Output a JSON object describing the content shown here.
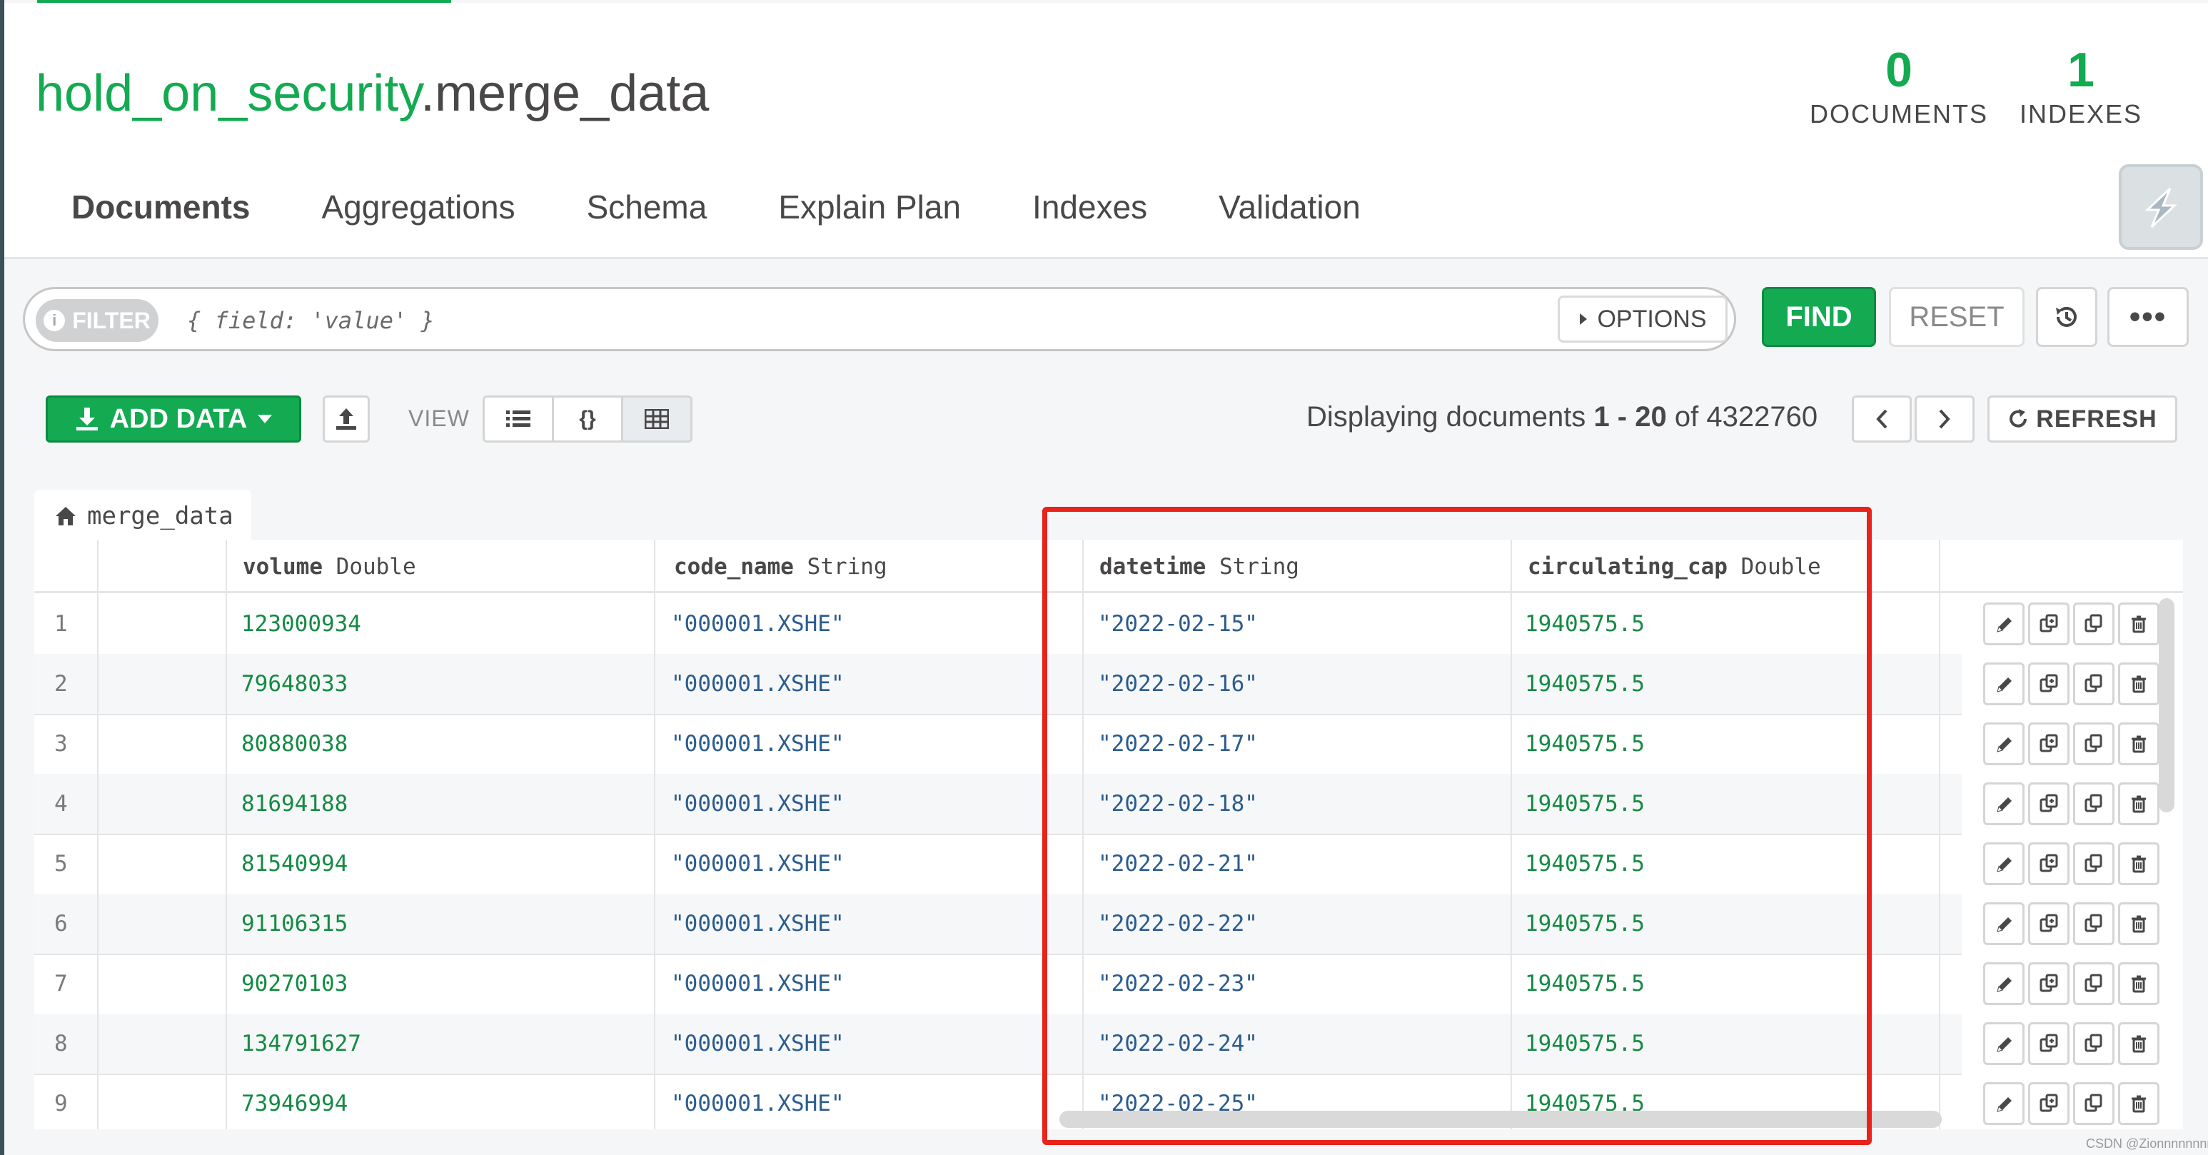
{
  "header": {
    "db_name": "hold_on_security",
    "collection_name": ".merge_data",
    "stats": [
      {
        "value": "0",
        "label": "DOCUMENTS"
      },
      {
        "value": "1",
        "label": "INDEXES"
      }
    ]
  },
  "tabs": [
    {
      "label": "Documents",
      "active": true
    },
    {
      "label": "Aggregations"
    },
    {
      "label": "Schema"
    },
    {
      "label": "Explain Plan"
    },
    {
      "label": "Indexes"
    },
    {
      "label": "Validation"
    }
  ],
  "filter": {
    "pill_label": "FILTER",
    "placeholder": "{ field: 'value' }",
    "options_label": "OPTIONS",
    "find_label": "FIND",
    "reset_label": "RESET",
    "more_label": "•••"
  },
  "toolbar": {
    "add_data_label": "ADD DATA",
    "view_label": "VIEW",
    "view_modes": [
      "list",
      "json",
      "table"
    ],
    "active_view": "table",
    "display_prefix": "Displaying documents",
    "range": "1 - 20",
    "of_label": "of",
    "total": "4322760",
    "refresh_label": "REFRESH"
  },
  "collection_tab": {
    "label": "merge_data"
  },
  "table": {
    "columns": [
      {
        "name": "volume",
        "type": "Double"
      },
      {
        "name": "code_name",
        "type": "String"
      },
      {
        "name": "datetime",
        "type": "String"
      },
      {
        "name": "circulating_cap",
        "type": "Double"
      }
    ],
    "rows": [
      {
        "idx": "1",
        "volume": "123000934",
        "code_name": "\"000001.XSHE\"",
        "datetime": "\"2022-02-15\"",
        "circulating_cap": "1940575.5"
      },
      {
        "idx": "2",
        "volume": "79648033",
        "code_name": "\"000001.XSHE\"",
        "datetime": "\"2022-02-16\"",
        "circulating_cap": "1940575.5"
      },
      {
        "idx": "3",
        "volume": "80880038",
        "code_name": "\"000001.XSHE\"",
        "datetime": "\"2022-02-17\"",
        "circulating_cap": "1940575.5"
      },
      {
        "idx": "4",
        "volume": "81694188",
        "code_name": "\"000001.XSHE\"",
        "datetime": "\"2022-02-18\"",
        "circulating_cap": "1940575.5"
      },
      {
        "idx": "5",
        "volume": "81540994",
        "code_name": "\"000001.XSHE\"",
        "datetime": "\"2022-02-21\"",
        "circulating_cap": "1940575.5"
      },
      {
        "idx": "6",
        "volume": "91106315",
        "code_name": "\"000001.XSHE\"",
        "datetime": "\"2022-02-22\"",
        "circulating_cap": "1940575.5"
      },
      {
        "idx": "7",
        "volume": "90270103",
        "code_name": "\"000001.XSHE\"",
        "datetime": "\"2022-02-23\"",
        "circulating_cap": "1940575.5"
      },
      {
        "idx": "8",
        "volume": "134791627",
        "code_name": "\"000001.XSHE\"",
        "datetime": "\"2022-02-24\"",
        "circulating_cap": "1940575.5"
      },
      {
        "idx": "9",
        "volume": "73946994",
        "code_name": "\"000001.XSHE\"",
        "datetime": "\"2022-02-25\"",
        "circulating_cap": "1940575.5"
      }
    ],
    "row_actions": [
      "edit-icon",
      "clone-icon",
      "copy-icon",
      "delete-icon"
    ]
  },
  "watermark": "CSDN @Zionnnnnnnn",
  "colors": {
    "accent": "#13aa52",
    "highlight": "#e8231c"
  }
}
